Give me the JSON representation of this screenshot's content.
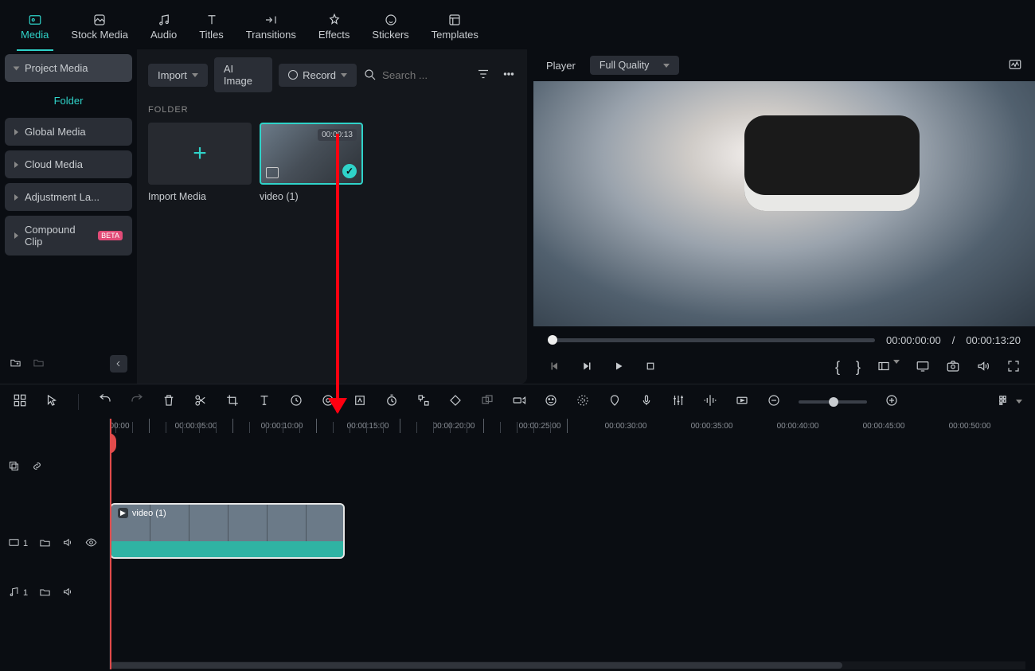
{
  "tabs": {
    "media": "Media",
    "stock": "Stock Media",
    "audio": "Audio",
    "titles": "Titles",
    "transitions": "Transitions",
    "effects": "Effects",
    "stickers": "Stickers",
    "templates": "Templates"
  },
  "sidebar": {
    "project_media": "Project Media",
    "folder": "Folder",
    "global_media": "Global Media",
    "cloud_media": "Cloud Media",
    "adjustment": "Adjustment La...",
    "compound": "Compound Clip",
    "beta": "BETA"
  },
  "media_panel": {
    "import": "Import",
    "ai_image": "AI Image",
    "record": "Record",
    "search_placeholder": "Search ...",
    "folder_label": "FOLDER",
    "import_media": "Import Media",
    "clip_name": "video (1)",
    "clip_duration": "00:00:13"
  },
  "player": {
    "label": "Player",
    "quality": "Full Quality",
    "time_current": "00:00:00:00",
    "separator": "/",
    "time_total": "00:00:13:20"
  },
  "timeline": {
    "ruler": [
      "00:00",
      "00:00:05:00",
      "00:00:10:00",
      "00:00:15:00",
      "00:00:20:00",
      "00:00:25:00",
      "00:00:30:00",
      "00:00:35:00",
      "00:00:40:00",
      "00:00:45:00",
      "00:00:50:00"
    ],
    "video_track_index": "1",
    "audio_track_index": "1",
    "clip_label": "video (1)"
  }
}
